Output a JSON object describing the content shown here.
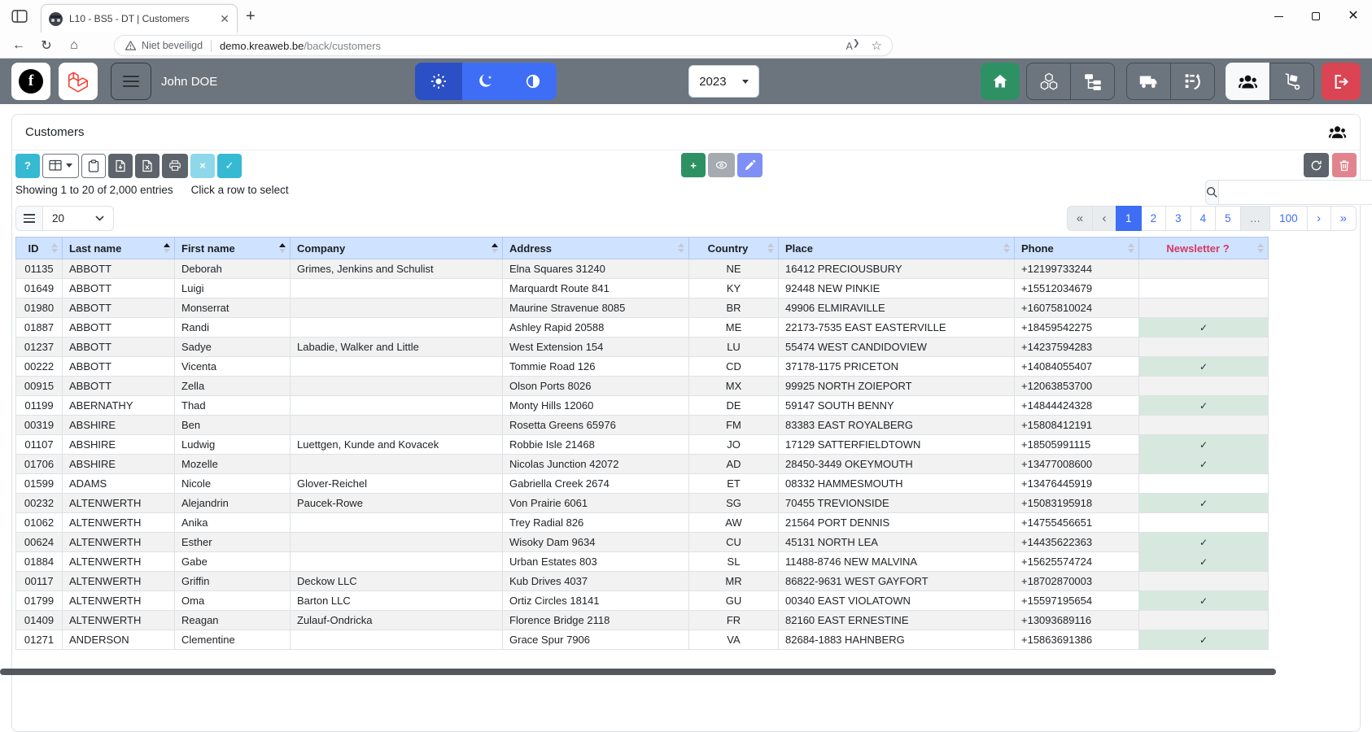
{
  "browser": {
    "tab": {
      "title": "L10 - BS5 - DT | Customers"
    },
    "address": {
      "security_label": "Niet beveiligd",
      "domain": "demo.kreaweb.be",
      "path": "/back/customers"
    }
  },
  "navbar": {
    "user_name": "John DOE",
    "year": "2023"
  },
  "card": {
    "title": "Customers",
    "toolbar_glyphs": {
      "help": "?",
      "cancel": "×",
      "confirm": "✓",
      "add": "+"
    },
    "info": "Showing 1 to 20 of 2,000 entries",
    "hint": "Click a row to select",
    "page_length": "20",
    "search_value": ""
  },
  "pagination": {
    "first": "«",
    "prev": "‹",
    "next": "›",
    "last": "»",
    "pages": [
      "1",
      "2",
      "3",
      "4",
      "5",
      "…",
      "100"
    ],
    "active": "1",
    "disabled": [
      "first",
      "prev"
    ]
  },
  "table": {
    "check_glyph": "✓",
    "columns": [
      {
        "label": "ID",
        "sorted": false,
        "accent": false
      },
      {
        "label": "Last name",
        "sorted": true,
        "accent": false
      },
      {
        "label": "First name",
        "sorted": true,
        "accent": false
      },
      {
        "label": "Company",
        "sorted": true,
        "accent": false
      },
      {
        "label": "Address",
        "sorted": false,
        "accent": false
      },
      {
        "label": "Country",
        "sorted": false,
        "accent": false
      },
      {
        "label": "Place",
        "sorted": false,
        "accent": false
      },
      {
        "label": "Phone",
        "sorted": false,
        "accent": false
      },
      {
        "label": "Newsletter ?",
        "sorted": false,
        "accent": true
      }
    ],
    "rows": [
      [
        "01135",
        "ABBOTT",
        "Deborah",
        "Grimes, Jenkins and Schulist",
        "Elna Squares 31240",
        "NE",
        "16412 PRECIOUSBURY",
        "+12199733244",
        false
      ],
      [
        "01649",
        "ABBOTT",
        "Luigi",
        "",
        "Marquardt Route 841",
        "KY",
        "92448 NEW PINKIE",
        "+15512034679",
        false
      ],
      [
        "01980",
        "ABBOTT",
        "Monserrat",
        "",
        "Maurine Stravenue 8085",
        "BR",
        "49906 ELMIRAVILLE",
        "+16075810024",
        false
      ],
      [
        "01887",
        "ABBOTT",
        "Randi",
        "",
        "Ashley Rapid 20588",
        "ME",
        "22173-7535 EAST EASTERVILLE",
        "+18459542275",
        true
      ],
      [
        "01237",
        "ABBOTT",
        "Sadye",
        "Labadie, Walker and Little",
        "West Extension 154",
        "LU",
        "55474 WEST CANDIDOVIEW",
        "+14237594283",
        false
      ],
      [
        "00222",
        "ABBOTT",
        "Vicenta",
        "",
        "Tommie Road 126",
        "CD",
        "37178-1175 PRICETON",
        "+14084055407",
        true
      ],
      [
        "00915",
        "ABBOTT",
        "Zella",
        "",
        "Olson Ports 8026",
        "MX",
        "99925 NORTH ZOIEPORT",
        "+12063853700",
        false
      ],
      [
        "01199",
        "ABERNATHY",
        "Thad",
        "",
        "Monty Hills 12060",
        "DE",
        "59147 SOUTH BENNY",
        "+14844424328",
        true
      ],
      [
        "00319",
        "ABSHIRE",
        "Ben",
        "",
        "Rosetta Greens 65976",
        "FM",
        "83383 EAST ROYALBERG",
        "+15808412191",
        false
      ],
      [
        "01107",
        "ABSHIRE",
        "Ludwig",
        "Luettgen, Kunde and Kovacek",
        "Robbie Isle 21468",
        "JO",
        "17129 SATTERFIELDTOWN",
        "+18505991115",
        true
      ],
      [
        "01706",
        "ABSHIRE",
        "Mozelle",
        "",
        "Nicolas Junction 42072",
        "AD",
        "28450-3449 OKEYMOUTH",
        "+13477008600",
        true
      ],
      [
        "01599",
        "ADAMS",
        "Nicole",
        "Glover-Reichel",
        "Gabriella Creek 2674",
        "ET",
        "08332 HAMMESMOUTH",
        "+13476445919",
        false
      ],
      [
        "00232",
        "ALTENWERTH",
        "Alejandrin",
        "Paucek-Rowe",
        "Von Prairie 6061",
        "SG",
        "70455 TREVIONSIDE",
        "+15083195918",
        true
      ],
      [
        "01062",
        "ALTENWERTH",
        "Anika",
        "",
        "Trey Radial 826",
        "AW",
        "21564 PORT DENNIS",
        "+14755456651",
        false
      ],
      [
        "00624",
        "ALTENWERTH",
        "Esther",
        "",
        "Wisoky Dam 9634",
        "CU",
        "45131 NORTH LEA",
        "+14435622363",
        true
      ],
      [
        "01884",
        "ALTENWERTH",
        "Gabe",
        "",
        "Urban Estates 803",
        "SL",
        "11488-8746 NEW MALVINA",
        "+15625574724",
        true
      ],
      [
        "00117",
        "ALTENWERTH",
        "Griffin",
        "Deckow LLC",
        "Kub Drives 4037",
        "MR",
        "86822-9631 WEST GAYFORT",
        "+18702870003",
        false
      ],
      [
        "01799",
        "ALTENWERTH",
        "Oma",
        "Barton LLC",
        "Ortiz Circles 18141",
        "GU",
        "00340 EAST VIOLATOWN",
        "+15597195654",
        true
      ],
      [
        "01409",
        "ALTENWERTH",
        "Reagan",
        "Zulauf-Ondricka",
        "Florence Bridge 2118",
        "FR",
        "82160 EAST ERNESTINE",
        "+13093689116",
        false
      ],
      [
        "01271",
        "ANDERSON",
        "Clementine",
        "",
        "Grace Spur 7906",
        "VA",
        "82684-1883 HAHNBERG",
        "+15863691386",
        true
      ]
    ]
  },
  "colors": {
    "navbar_gray": "#6c757d",
    "accent_blue": "#3e6ef5",
    "theme_active_blue": "#2b50c5",
    "success_green": "#2e9164",
    "danger_red": "#db4453",
    "info_cyan": "#36b9d3",
    "table_header_blue": "#cfe2ff",
    "newsletter_red": "#d53a61",
    "newsletter_check_bg": "#d7e8de",
    "row_stripe": "#f2f2f2"
  }
}
